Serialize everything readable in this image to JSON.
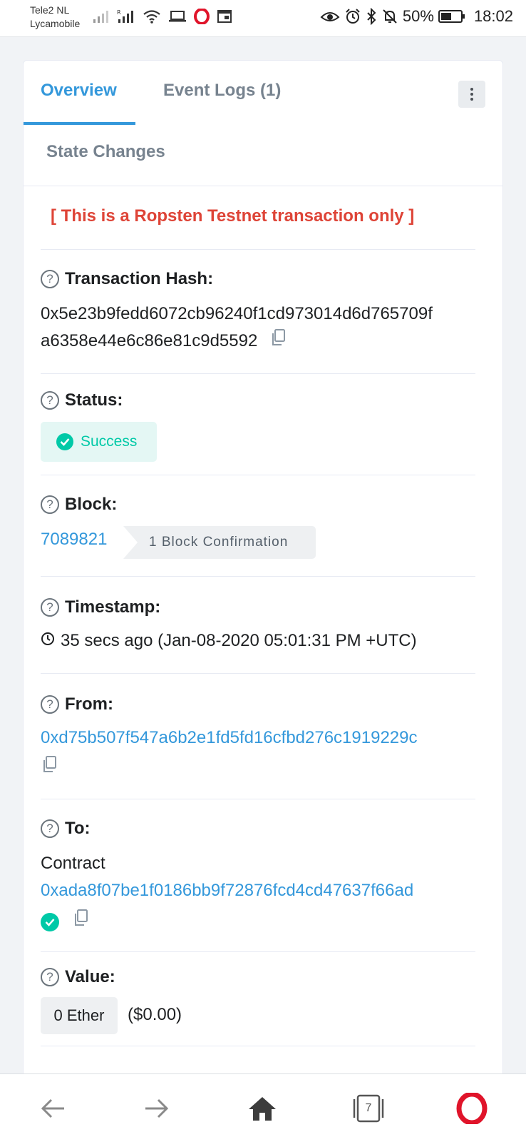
{
  "statusbar": {
    "carrier1": "Tele2 NL",
    "carrier2": "Lycamobile",
    "battery": "50%",
    "time": "18:02"
  },
  "tabs": {
    "overview": "Overview",
    "event_logs": "Event Logs (1)",
    "state_changes": "State Changes"
  },
  "notice": "[ This is a Ropsten Testnet transaction only ]",
  "tx_hash": {
    "label": "Transaction Hash:",
    "line1": "0x5e23b9fedd6072cb96240f1cd973014d6d765709f",
    "line2": "a6358e44e6c86e81c9d5592"
  },
  "status": {
    "label": "Status:",
    "value": "Success"
  },
  "block": {
    "label": "Block:",
    "number": "7089821",
    "confirmations": "1 Block Confirmation"
  },
  "timestamp": {
    "label": "Timestamp:",
    "value": "35 secs ago (Jan-08-2020 05:01:31 PM +UTC)"
  },
  "from": {
    "label": "From:",
    "address": "0xd75b507f547a6b2e1fd5fd16cfbd276c1919229c"
  },
  "to": {
    "label": "To:",
    "prefix": "Contract",
    "address": "0xada8f07be1f0186bb9f72876fcd4cd47637f66ad"
  },
  "value": {
    "label": "Value:",
    "amount": "0 Ether",
    "usd": "($0.00)"
  },
  "bottomnav": {
    "tab_count": "7"
  },
  "colors": {
    "link": "#3498db",
    "danger": "#de4437",
    "success": "#00c9a7",
    "opera": "#e0142a"
  }
}
